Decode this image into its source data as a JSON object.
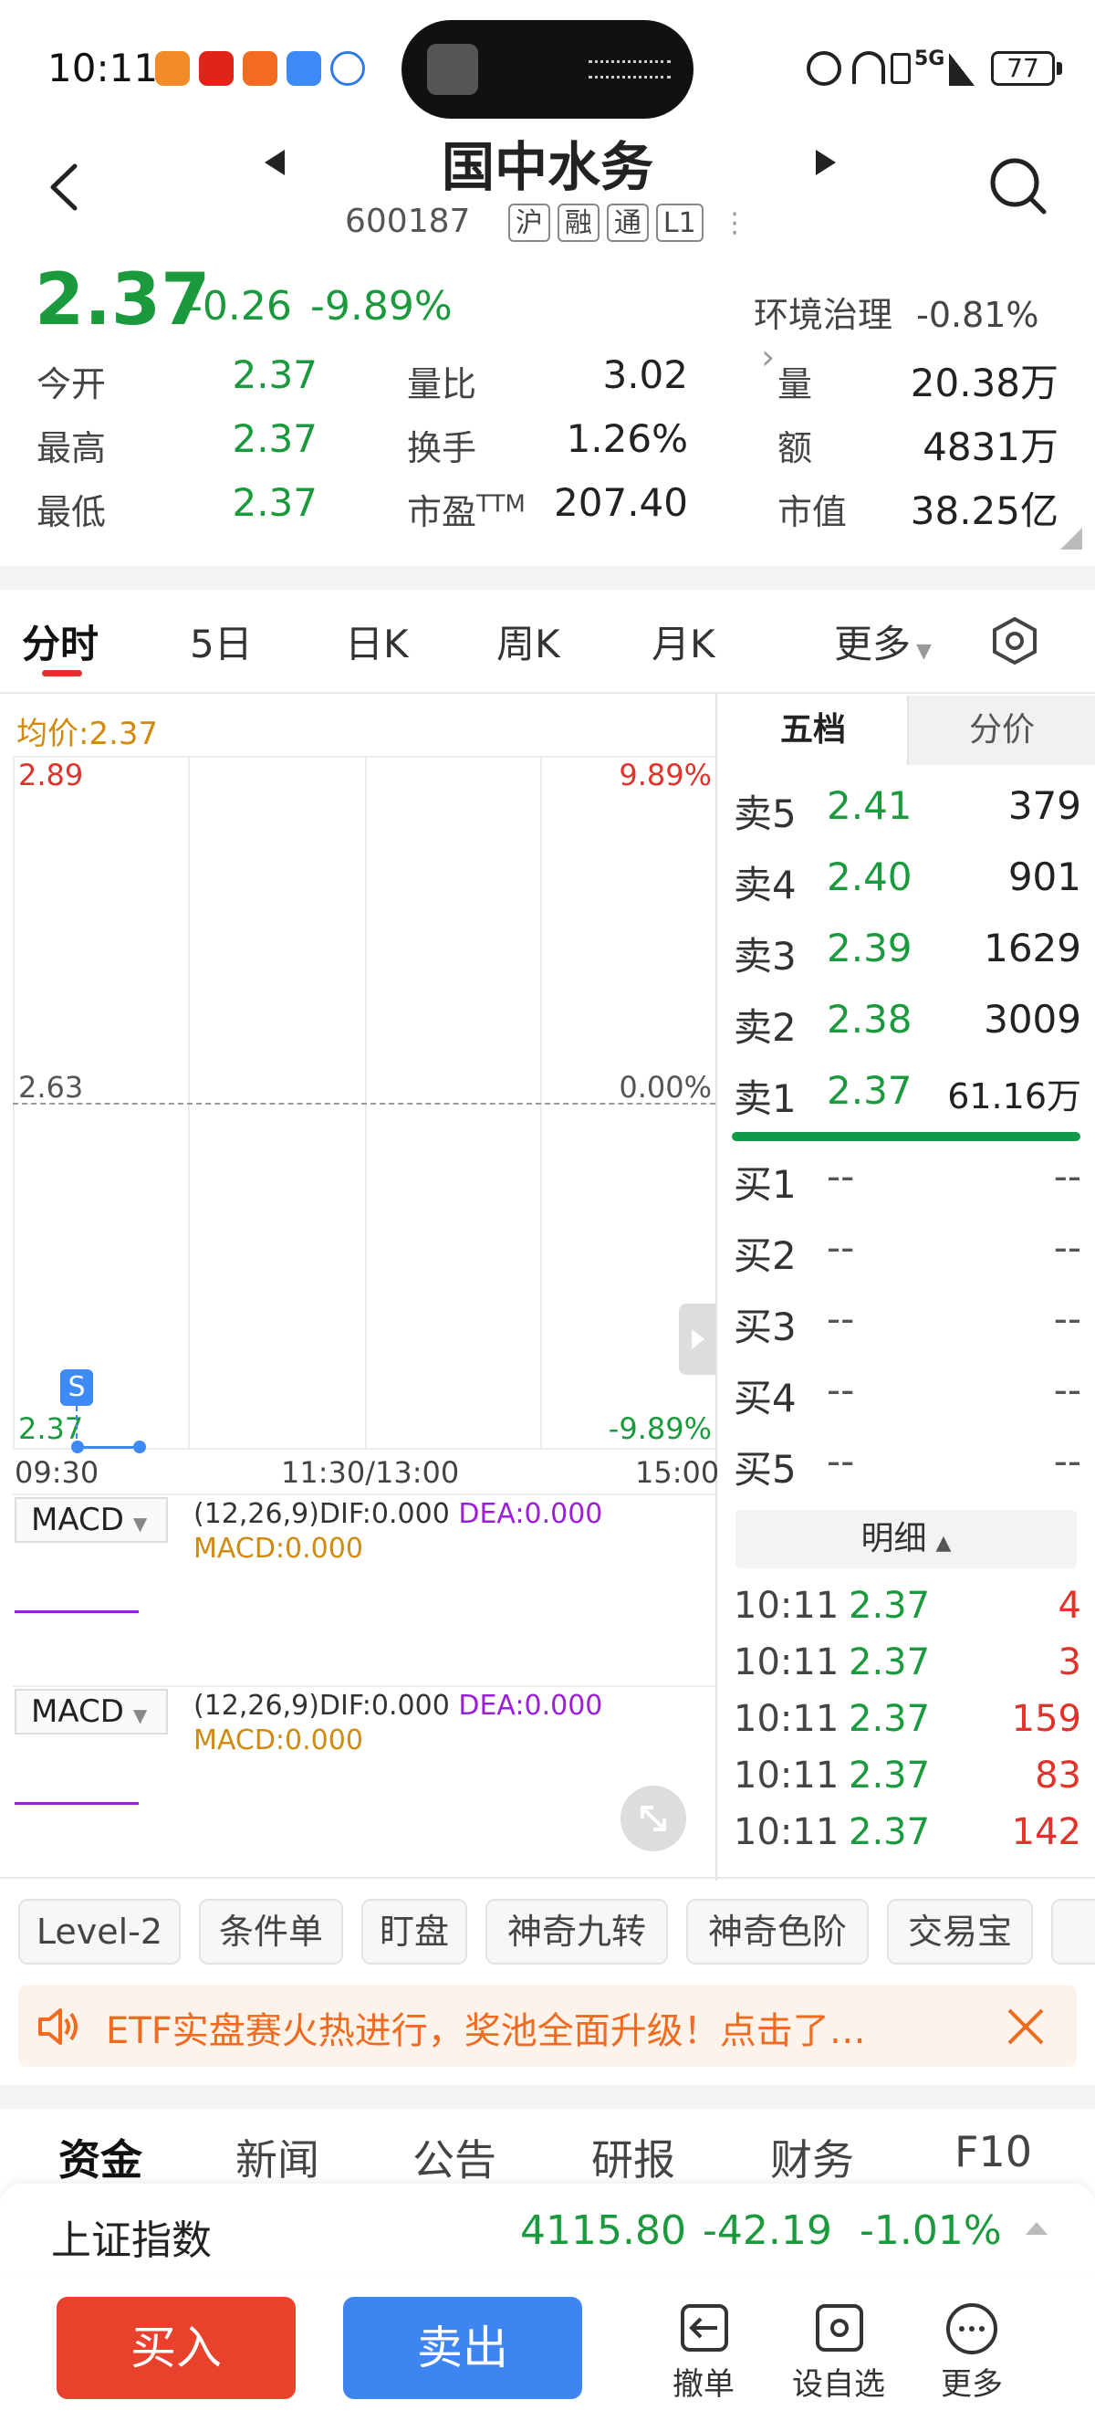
{
  "status": {
    "time": "10:11",
    "network": "5G",
    "battery": "77"
  },
  "header": {
    "title": "国中水务",
    "code": "600187",
    "tags": [
      "沪",
      "融",
      "通",
      "L1"
    ]
  },
  "quote": {
    "price": "2.37",
    "change": "-0.26",
    "change_pct": "-9.89%",
    "sector_name": "环境治理",
    "sector_pct": "-0.81%",
    "open_label": "今开",
    "open": "2.37",
    "high_label": "最高",
    "high": "2.37",
    "low_label": "最低",
    "low": "2.37",
    "vol_ratio_label": "量比",
    "vol_ratio": "3.02",
    "turnover_label": "换手",
    "turnover": "1.26%",
    "pe_label": "市盈",
    "pe_sup": "TTM",
    "pe": "207.40",
    "volume_label": "量",
    "volume": "20.38万",
    "amount_label": "额",
    "amount": "4831万",
    "mktcap_label": "市值",
    "mktcap": "38.25亿"
  },
  "tabs": [
    "分时",
    "5日",
    "日K",
    "周K",
    "月K",
    "更多"
  ],
  "chart": {
    "avg_label": "均价:2.37",
    "y_top": "2.89",
    "y_mid": "2.63",
    "y_bot": "2.37",
    "pct_top": "9.89%",
    "pct_mid": "0.00%",
    "pct_bot": "-9.89%",
    "x_start": "09:30",
    "x_mid": "11:30/13:00",
    "x_end": "15:00",
    "signal": "S"
  },
  "macd": [
    {
      "label": "MACD",
      "params": "(12,26,9)",
      "dif": "DIF:0.000",
      "dea": "DEA:0.000",
      "macd": "MACD:0.000"
    },
    {
      "label": "MACD",
      "params": "(12,26,9)",
      "dif": "DIF:0.000",
      "dea": "DEA:0.000",
      "macd": "MACD:0.000"
    }
  ],
  "orderbook": {
    "tab_five": "五档",
    "tab_price": "分价",
    "sells": [
      {
        "label": "卖5",
        "price": "2.41",
        "vol": "379"
      },
      {
        "label": "卖4",
        "price": "2.40",
        "vol": "901"
      },
      {
        "label": "卖3",
        "price": "2.39",
        "vol": "1629"
      },
      {
        "label": "卖2",
        "price": "2.38",
        "vol": "3009"
      },
      {
        "label": "卖1",
        "price": "2.37",
        "vol": "61.16万"
      }
    ],
    "buys": [
      {
        "label": "买1",
        "price": "--",
        "vol": "--"
      },
      {
        "label": "买2",
        "price": "--",
        "vol": "--"
      },
      {
        "label": "买3",
        "price": "--",
        "vol": "--"
      },
      {
        "label": "买4",
        "price": "--",
        "vol": "--"
      },
      {
        "label": "买5",
        "price": "--",
        "vol": "--"
      }
    ],
    "detail_label": "明细",
    "details": [
      {
        "time": "10:11",
        "price": "2.37",
        "vol": "4"
      },
      {
        "time": "10:11",
        "price": "2.37",
        "vol": "3"
      },
      {
        "time": "10:11",
        "price": "2.37",
        "vol": "159"
      },
      {
        "time": "10:11",
        "price": "2.37",
        "vol": "83"
      },
      {
        "time": "10:11",
        "price": "2.37",
        "vol": "142"
      }
    ]
  },
  "tools": [
    "Level-2",
    "条件单",
    "盯盘",
    "神奇九转",
    "神奇色阶",
    "交易宝"
  ],
  "banner": "ETF实盘赛火热进行，奖池全面升级！点击了…",
  "bottom_tabs": [
    "资金",
    "新闻",
    "公告",
    "研报",
    "财务",
    "F10"
  ],
  "index": {
    "name": "上证指数",
    "value": "4115.80",
    "change": "-42.19",
    "pct": "-1.01%"
  },
  "actions": {
    "buy": "买入",
    "sell": "卖出",
    "cancel": "撤单",
    "watch": "设自选",
    "more": "更多"
  }
}
